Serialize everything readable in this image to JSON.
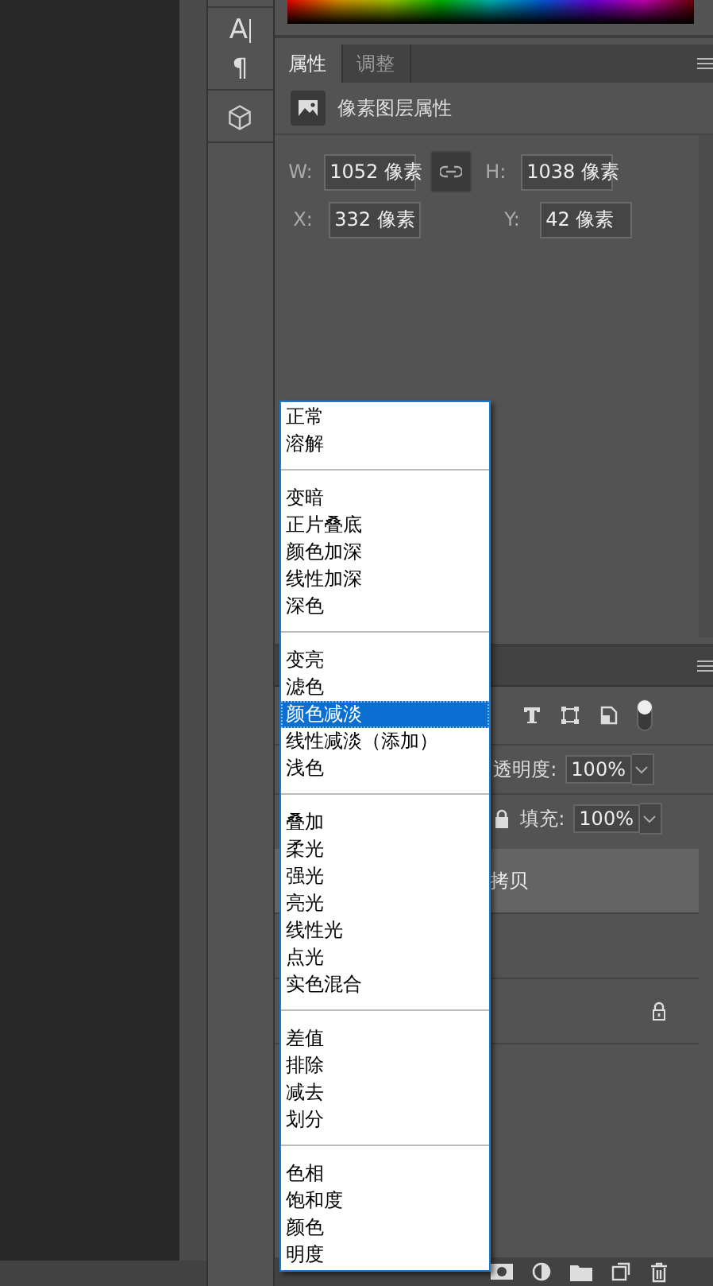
{
  "tools": {
    "character": "A",
    "paragraph": "¶"
  },
  "properties": {
    "tabs": [
      {
        "label": "属性",
        "selected": true
      },
      {
        "label": "调整",
        "selected": false
      }
    ],
    "header": "像素图层属性",
    "fields": [
      {
        "label": "W:",
        "value": "1052 像素"
      },
      {
        "label": "H:",
        "value": "1038 像素"
      },
      {
        "label": "X:",
        "value": "332 像素"
      },
      {
        "label": "Y:",
        "value": "42 像素"
      }
    ]
  },
  "layers": {
    "opacity_label": "透明度:",
    "opacity": "100%",
    "fill_label": "填充:",
    "fill": "100%",
    "rows": [
      {
        "name": "拷贝",
        "selected": true,
        "locked": false
      },
      {
        "selected": false,
        "locked": false
      },
      {
        "selected": false,
        "locked": true
      }
    ]
  },
  "blend_menu": {
    "groups": [
      [
        {
          "label": "正常",
          "selected": false
        },
        {
          "label": "溶解",
          "selected": false
        }
      ],
      [
        {
          "label": "变暗",
          "selected": false
        },
        {
          "label": "正片叠底",
          "selected": false
        },
        {
          "label": "颜色加深",
          "selected": false
        },
        {
          "label": "线性加深",
          "selected": false
        },
        {
          "label": "深色",
          "selected": false
        }
      ],
      [
        {
          "label": "变亮",
          "selected": false
        },
        {
          "label": "滤色",
          "selected": false
        },
        {
          "label": "颜色减淡",
          "selected": true
        },
        {
          "label": "线性减淡（添加）",
          "selected": false
        },
        {
          "label": "浅色",
          "selected": false
        }
      ],
      [
        {
          "label": "叠加",
          "selected": false
        },
        {
          "label": "柔光",
          "selected": false
        },
        {
          "label": "强光",
          "selected": false
        },
        {
          "label": "亮光",
          "selected": false
        },
        {
          "label": "线性光",
          "selected": false
        },
        {
          "label": "点光",
          "selected": false
        },
        {
          "label": "实色混合",
          "selected": false
        }
      ],
      [
        {
          "label": "差值",
          "selected": false
        },
        {
          "label": "排除",
          "selected": false
        },
        {
          "label": "减去",
          "selected": false
        },
        {
          "label": "划分",
          "selected": false
        }
      ],
      [
        {
          "label": "色相",
          "selected": false
        },
        {
          "label": "饱和度",
          "selected": false
        },
        {
          "label": "颜色",
          "selected": false
        },
        {
          "label": "明度",
          "selected": false
        }
      ]
    ]
  }
}
